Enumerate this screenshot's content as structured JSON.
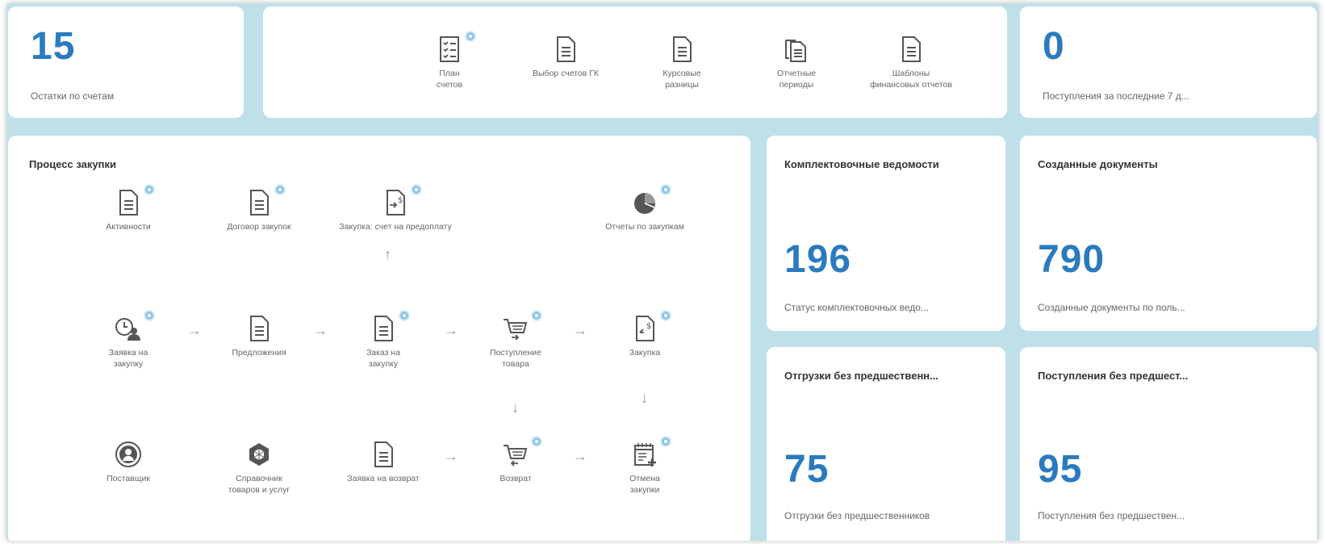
{
  "kpi_accounts": {
    "value": "15",
    "label": "Остатки по счетам"
  },
  "toolbar": {
    "items": [
      {
        "label": "План счетов"
      },
      {
        "label": "Выбор счетов ГК"
      },
      {
        "label": "Курсовые разницы"
      },
      {
        "label": "Отчетные периоды"
      },
      {
        "label": "Шаблоны финансовых отчетов"
      }
    ]
  },
  "kpi_receipts": {
    "value": "0",
    "label": "Поступления за последние 7 д..."
  },
  "purchase": {
    "title": "Процесс закупки",
    "row1": [
      "Активности",
      "Договор закупок",
      "Закупка: счет на предоплату",
      "Отчеты по закупкам"
    ],
    "row2": [
      "Заявка на закупку",
      "Предложения",
      "Заказ на закупку",
      "Поступление товара",
      "Закупка"
    ],
    "row3": [
      "Поставщик",
      "Справочник товаров и услуг",
      "Заявка на возврат",
      "Возврат",
      "Отмена закупки"
    ]
  },
  "kpi_kits": {
    "title": "Комплектовочные ведомости",
    "value": "196",
    "label": "Статус комплектовочных ведо..."
  },
  "kpi_docs": {
    "title": "Созданные документы",
    "value": "790",
    "label": "Созданные документы по поль..."
  },
  "kpi_shipments": {
    "title": "Отгрузки без предшественн...",
    "value": "75",
    "label": "Отгрузки без предшественников"
  },
  "kpi_incoming": {
    "title": "Поступления без предшест...",
    "value": "95",
    "label": "Поступления без предшествен..."
  },
  "colors": {
    "accent": "#2a7abf",
    "background": "#bfe0e8",
    "badge": "#8ec5e6"
  }
}
